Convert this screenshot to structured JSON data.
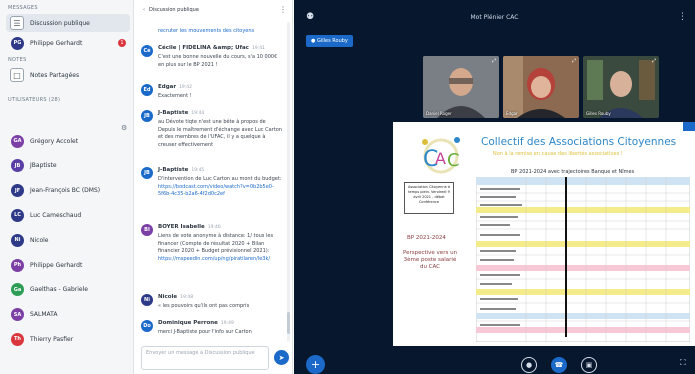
{
  "sidebar": {
    "messages_head": "MESSAGES",
    "items": [
      {
        "label": "Discussion publique",
        "icon": "chat-bubbles-icon"
      },
      {
        "label": "Philippe Gerhardt",
        "badge": "1",
        "color": "#2e3a88",
        "initials": "PG"
      }
    ],
    "notes_head": "NOTES",
    "notes_item": "Notes Partagées",
    "users_head": "UTILISATEURS (28)",
    "users": [
      {
        "name": "Grégory Accolet",
        "initials": "GA",
        "color": "#7b3fa6"
      },
      {
        "name": "JBaptiste",
        "initials": "JB",
        "color": "#5b3fa6"
      },
      {
        "name": "Jean-François BC (DMS)",
        "initials": "JF",
        "color": "#2e3a88"
      },
      {
        "name": "Luc Cameschaud",
        "initials": "LC",
        "color": "#2e3a88"
      },
      {
        "name": "Nicole",
        "initials": "Ni",
        "color": "#2e3a88"
      },
      {
        "name": "Philippe Gerhardt",
        "initials": "Ph",
        "color": "#7b3fa6"
      },
      {
        "name": "Gaelthas - Gabriele",
        "initials": "Ga",
        "color": "#2e9e57"
      },
      {
        "name": "SALMATA",
        "initials": "SA",
        "color": "#7b3fa6"
      },
      {
        "name": "Thierry Pasfier",
        "initials": "Th",
        "color": "#d9363e"
      }
    ]
  },
  "chat": {
    "header": "Discussion publique",
    "messages": [
      {
        "name": "",
        "time": "",
        "text": "recruter les mouvements des citoyens",
        "initials": "",
        "color": ""
      },
      {
        "name": "Cécile | FIDELINA &amp; Ufac",
        "time": "19:41",
        "text": "C'est une bonne nouvelle du cours, s'a 10 000€ en plus sur le BP 2021 !",
        "initials": "Cé",
        "color": "#1b6ac9"
      },
      {
        "name": "Edgar",
        "time": "19:42",
        "text": "Exactement !",
        "initials": "Ed",
        "color": "#1b6ac9"
      },
      {
        "name": "J-Baptiste",
        "time": "19:44",
        "text": "au Dévote tiqte n'est une bête à propos de Depuis le maîtrement d'échange avec Luc Carton et des membres de l'UFAC, il y a quelque à creuser effectivement",
        "initials": "JB",
        "color": "#1b6ac9"
      },
      {
        "name": "J-Baptiste",
        "time": "19:45",
        "text": "D'intervention de Luc Carton au mont du budget: ",
        "link": "https://bodcast.com/video/watch?v=0b2b5e0-5f6b-4c35-b2a6-4f2d0c2ef",
        "initials": "JB",
        "color": "#1b6ac9"
      },
      {
        "name": "BOYER Isabelle",
        "time": "19:46",
        "text": "Liens de vote anonyme à distance: 1/ tous les financer (Compte de résultat 2020 + Bilan financier 2020 + Budget prévisionnel 2021): ",
        "link": "https://mspeedin.com/up/ng/piratilaren/le3k/",
        "initials": "BI",
        "color": "#7b3fa6"
      },
      {
        "name": "Nicole",
        "time": "19:48",
        "text": "« les pouvoirs qu'ils ont pas compris",
        "initials": "Ni",
        "color": "#2e3a88"
      },
      {
        "name": "Dominique Perrone",
        "time": "19:49",
        "text": "merci J-Baptiste pour l'info sur Carton",
        "initials": "Do",
        "color": "#1b6ac9"
      }
    ],
    "composer_placeholder": "Envoyer un message à Discussion publique",
    "send_icon": "send-arrow-icon"
  },
  "stage": {
    "title": "Mot Plénier CAC",
    "talker": "Gilles Rouby",
    "webcams": [
      {
        "name": "Daniel Roger",
        "bg": "#7a7f86"
      },
      {
        "name": "Edgar",
        "bg": "#8c6a52"
      },
      {
        "name": "Gilles Rouby",
        "bg": "#3a4a3e"
      }
    ],
    "slide": {
      "title": "Collectif des Associations Citoyennes",
      "subtitle": "Non à la remise en cause des libertés associatives !",
      "heading": "BP 2021-2024 avec trajectoires Banque et Nîmes",
      "box_text": "Association Citoyenne à temps plein. Vendredi 9 avril 2021 - débat Conférence",
      "bp": "BP 2021-2024",
      "perspective": "Perspective vers un 3ème poste salarié du CAC"
    },
    "controls": [
      "microphone-icon",
      "audio-icon",
      "camera-icon"
    ]
  }
}
